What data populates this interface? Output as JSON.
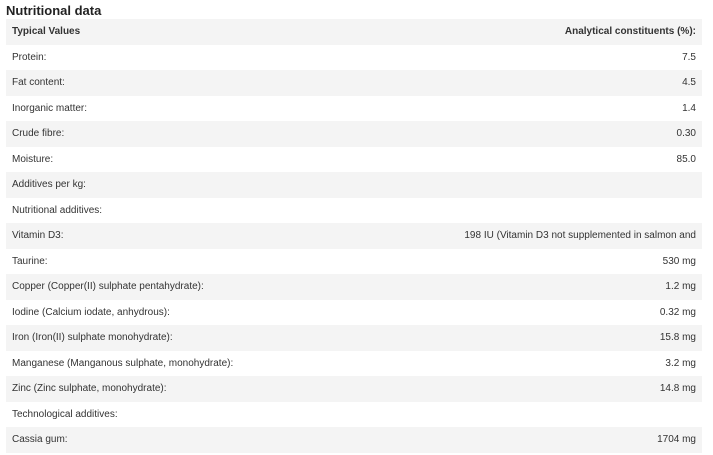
{
  "title": "Nutritional data",
  "headers": {
    "left": "Typical Values",
    "right": "Analytical constituents (%):"
  },
  "rows": [
    {
      "label": "Protein:",
      "value": "7.5"
    },
    {
      "label": "Fat content:",
      "value": "4.5"
    },
    {
      "label": "Inorganic matter:",
      "value": "1.4"
    },
    {
      "label": "Crude fibre:",
      "value": "0.30"
    },
    {
      "label": "Moisture:",
      "value": "85.0"
    },
    {
      "label": "Additives per kg:",
      "value": ""
    },
    {
      "label": "Nutritional additives:",
      "value": ""
    },
    {
      "label": "Vitamin D3:",
      "value": "198 IU (Vitamin D3 not supplemented in salmon and"
    },
    {
      "label": "Taurine:",
      "value": "530 mg"
    },
    {
      "label": "Copper (Copper(II) sulphate pentahydrate):",
      "value": "1.2 mg"
    },
    {
      "label": "Iodine (Calcium iodate, anhydrous):",
      "value": "0.32 mg"
    },
    {
      "label": "Iron (Iron(II) sulphate monohydrate):",
      "value": "15.8 mg"
    },
    {
      "label": "Manganese (Manganous sulphate, monohydrate):",
      "value": "3.2 mg"
    },
    {
      "label": "Zinc (Zinc sulphate, monohydrate):",
      "value": "14.8 mg"
    },
    {
      "label": "Technological additives:",
      "value": ""
    },
    {
      "label": "Cassia gum:",
      "value": "1704 mg"
    }
  ]
}
